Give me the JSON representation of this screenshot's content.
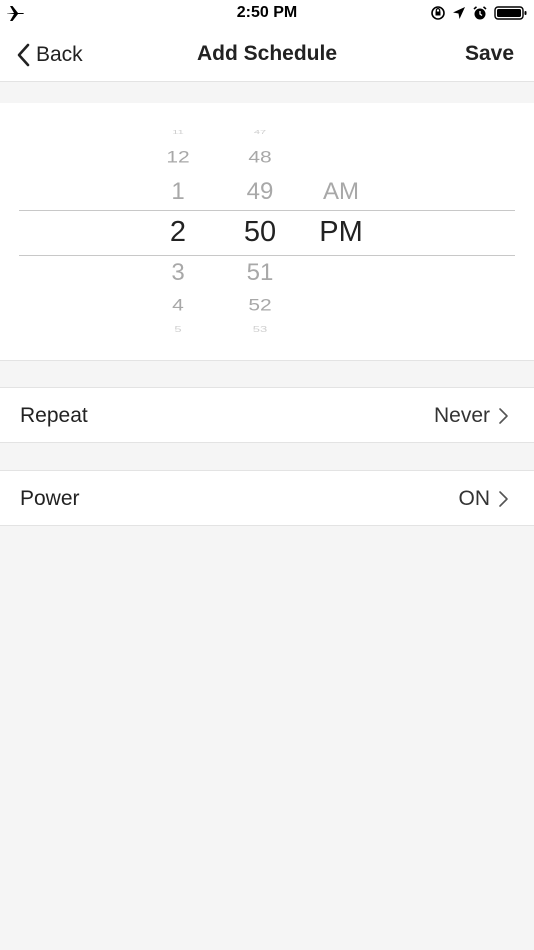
{
  "status_bar": {
    "time": "2:50 PM",
    "icons": [
      "airplane-icon",
      "orientation-lock-icon",
      "location-arrow-icon",
      "alarm-icon",
      "battery-icon"
    ]
  },
  "nav": {
    "back_label": "Back",
    "title": "Add Schedule",
    "save_label": "Save"
  },
  "picker": {
    "hours": [
      "11",
      "12",
      "1",
      "2",
      "3",
      "4",
      "5"
    ],
    "minutes": [
      "47",
      "48",
      "49",
      "50",
      "51",
      "52",
      "53"
    ],
    "periods": [
      "AM",
      "PM"
    ],
    "selected_hour": "2",
    "selected_minute": "50",
    "selected_period": "PM"
  },
  "rows": {
    "repeat": {
      "label": "Repeat",
      "value": "Never"
    },
    "power": {
      "label": "Power",
      "value": "ON"
    }
  },
  "colors": {
    "background": "#f5f5f5",
    "surface": "#ffffff",
    "text": "#222222",
    "picker_faded": "#a8a8a8",
    "separator": "#e3e3e3"
  }
}
